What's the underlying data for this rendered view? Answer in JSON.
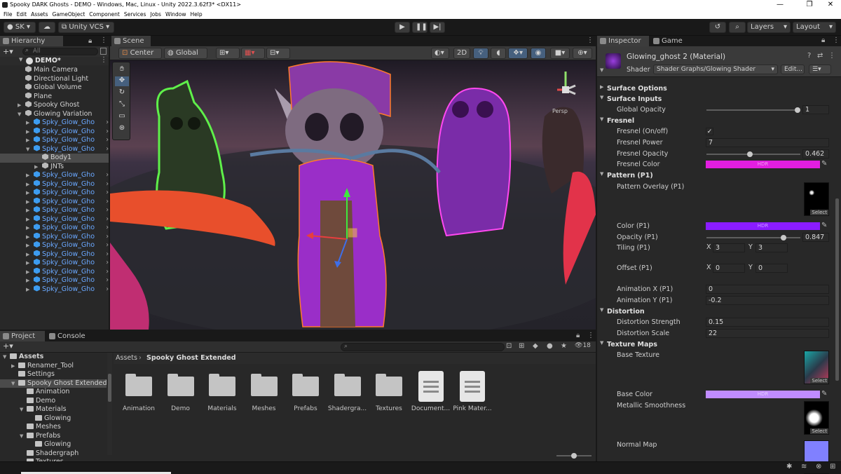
{
  "window": {
    "title": "Spooky DARK Ghosts - DEMO - Windows, Mac, Linux - Unity 2022.3.62f3* <DX11>",
    "min": "—",
    "max": "❐",
    "close": "✕"
  },
  "menu": [
    "File",
    "Edit",
    "Assets",
    "GameObject",
    "Component",
    "Services",
    "Jobs",
    "Window",
    "Help"
  ],
  "toolbar": {
    "account": "SK",
    "vcs": "Unity VCS",
    "layers": "Layers",
    "layout": "Layout"
  },
  "hierarchy": {
    "tab": "Hierarchy",
    "search_placeholder": "All",
    "scene": "DEMO*",
    "items": [
      {
        "label": "Main Camera",
        "d": 1,
        "kind": "g"
      },
      {
        "label": "Directional Light",
        "d": 1,
        "kind": "g"
      },
      {
        "label": "Global Volume",
        "d": 1,
        "kind": "g"
      },
      {
        "label": "Plane",
        "d": 1,
        "kind": "g"
      },
      {
        "label": "Spooky Ghost",
        "d": 1,
        "kind": "g",
        "fold": "▶"
      },
      {
        "label": "Glowing Variation",
        "d": 1,
        "kind": "g",
        "fold": "▼"
      },
      {
        "label": "Spky_Glow_Gho",
        "d": 2,
        "kind": "b",
        "fold": "▶"
      },
      {
        "label": "Spky_Glow_Gho",
        "d": 2,
        "kind": "b",
        "fold": "▶"
      },
      {
        "label": "Spky_Glow_Gho",
        "d": 2,
        "kind": "b",
        "fold": "▶"
      },
      {
        "label": "Spky_Glow_Gho",
        "d": 2,
        "kind": "b",
        "fold": "▼"
      },
      {
        "label": "Body1",
        "d": 3,
        "kind": "g",
        "sel": true
      },
      {
        "label": "JNTs",
        "d": 3,
        "kind": "g",
        "fold": "▶"
      },
      {
        "label": "Spky_Glow_Gho",
        "d": 2,
        "kind": "b",
        "fold": "▶"
      },
      {
        "label": "Spky_Glow_Gho",
        "d": 2,
        "kind": "b",
        "fold": "▶"
      },
      {
        "label": "Spky_Glow_Gho",
        "d": 2,
        "kind": "b",
        "fold": "▶"
      },
      {
        "label": "Spky_Glow_Gho",
        "d": 2,
        "kind": "b",
        "fold": "▶"
      },
      {
        "label": "Spky_Glow_Gho",
        "d": 2,
        "kind": "b",
        "fold": "▶"
      },
      {
        "label": "Spky_Glow_Gho",
        "d": 2,
        "kind": "b",
        "fold": "▶"
      },
      {
        "label": "Spky_Glow_Gho",
        "d": 2,
        "kind": "b",
        "fold": "▶"
      },
      {
        "label": "Spky_Glow_Gho",
        "d": 2,
        "kind": "b",
        "fold": "▶"
      },
      {
        "label": "Spky_Glow_Gho",
        "d": 2,
        "kind": "b",
        "fold": "▶"
      },
      {
        "label": "Spky_Glow_Gho",
        "d": 2,
        "kind": "b",
        "fold": "▶"
      },
      {
        "label": "Spky_Glow_Gho",
        "d": 2,
        "kind": "b",
        "fold": "▶"
      },
      {
        "label": "Spky_Glow_Gho",
        "d": 2,
        "kind": "b",
        "fold": "▶"
      },
      {
        "label": "Spky_Glow_Gho",
        "d": 2,
        "kind": "b",
        "fold": "▶"
      },
      {
        "label": "Spky_Glow_Gho",
        "d": 2,
        "kind": "b",
        "fold": "▶"
      }
    ]
  },
  "scene": {
    "tab": "Scene",
    "pivot": "Center",
    "space": "Global",
    "mode2d": "2D",
    "persp": "Persp"
  },
  "inspector": {
    "tab": "Inspector",
    "game_tab": "Game",
    "material": "Glowing_ghost 2 (Material)",
    "shader_label": "Shader",
    "shader": "Shader Graphs/Glowing Shader",
    "edit": "Edit...",
    "surface_options": "Surface Options",
    "surface_inputs": "Surface Inputs",
    "global_opacity_label": "Global Opacity",
    "global_opacity": "1",
    "fresnel": "Fresnel",
    "fresnel_onoff": "Fresnel (On/off)",
    "check": "✓",
    "fresnel_power_label": "Fresnel Power",
    "fresnel_power": "7",
    "fresnel_opacity_label": "Fresnel Opacity",
    "fresnel_opacity": "0.462",
    "fresnel_color_label": "Fresnel Color",
    "hdr": "HDR",
    "pattern": "Pattern (P1)",
    "pattern_overlay": "Pattern Overlay (P1)",
    "select": "Select",
    "color_p1": "Color (P1)",
    "opacity_p1_label": "Opacity (P1)",
    "opacity_p1": "0.847",
    "tiling_label": "Tiling (P1)",
    "tx": "3",
    "ty": "3",
    "offset_label": "Offset (P1)",
    "ox": "0",
    "oy": "0",
    "x": "X",
    "y": "Y",
    "anim_x_label": "Animation X (P1)",
    "anim_x": "0",
    "anim_y_label": "Animation Y (P1)",
    "anim_y": "-0.2",
    "distortion": "Distortion",
    "dist_strength_label": "Distortion Strength",
    "dist_strength": "0.15",
    "dist_scale_label": "Distortion Scale",
    "dist_scale": "22",
    "texture_maps": "Texture Maps",
    "base_texture": "Base Texture",
    "base_color": "Base Color",
    "metallic": "Metallic Smoothness",
    "normal_map": "Normal Map",
    "colors": {
      "fresnel": "#e21ee0",
      "p1": "#8a1cff",
      "base": "#c08cff",
      "normal": "#8080ff"
    }
  },
  "project": {
    "tab": "Project",
    "console_tab": "Console",
    "breadcrumb_root": "Assets",
    "breadcrumb_sep": "›",
    "breadcrumb_leaf": "Spooky Ghost Extended",
    "count": "18",
    "tree": [
      {
        "label": "Assets",
        "d": 0,
        "fold": "▼",
        "bold": true
      },
      {
        "label": "Renamer_Tool",
        "d": 1,
        "fold": "▶"
      },
      {
        "label": "Settings",
        "d": 1,
        "fold": ""
      },
      {
        "label": "Spooky Ghost Extended",
        "d": 1,
        "fold": "▼",
        "sel": true
      },
      {
        "label": "Animation",
        "d": 2,
        "fold": ""
      },
      {
        "label": "Demo",
        "d": 2,
        "fold": ""
      },
      {
        "label": "Materials",
        "d": 2,
        "fold": "▼"
      },
      {
        "label": "Glowing",
        "d": 3,
        "fold": ""
      },
      {
        "label": "Meshes",
        "d": 2,
        "fold": ""
      },
      {
        "label": "Prefabs",
        "d": 2,
        "fold": "▼"
      },
      {
        "label": "Glowing",
        "d": 3,
        "fold": ""
      },
      {
        "label": "Shadergraph",
        "d": 2,
        "fold": ""
      },
      {
        "label": "Textures",
        "d": 2,
        "fold": ""
      }
    ],
    "assets": [
      {
        "label": "Animation",
        "type": "folder"
      },
      {
        "label": "Demo",
        "type": "folder"
      },
      {
        "label": "Materials",
        "type": "folder"
      },
      {
        "label": "Meshes",
        "type": "folder"
      },
      {
        "label": "Prefabs",
        "type": "folder"
      },
      {
        "label": "Shadergra...",
        "type": "folder"
      },
      {
        "label": "Textures",
        "type": "folder"
      },
      {
        "label": "Document...",
        "type": "doc"
      },
      {
        "label": "Pink Mater...",
        "type": "doc"
      }
    ]
  }
}
